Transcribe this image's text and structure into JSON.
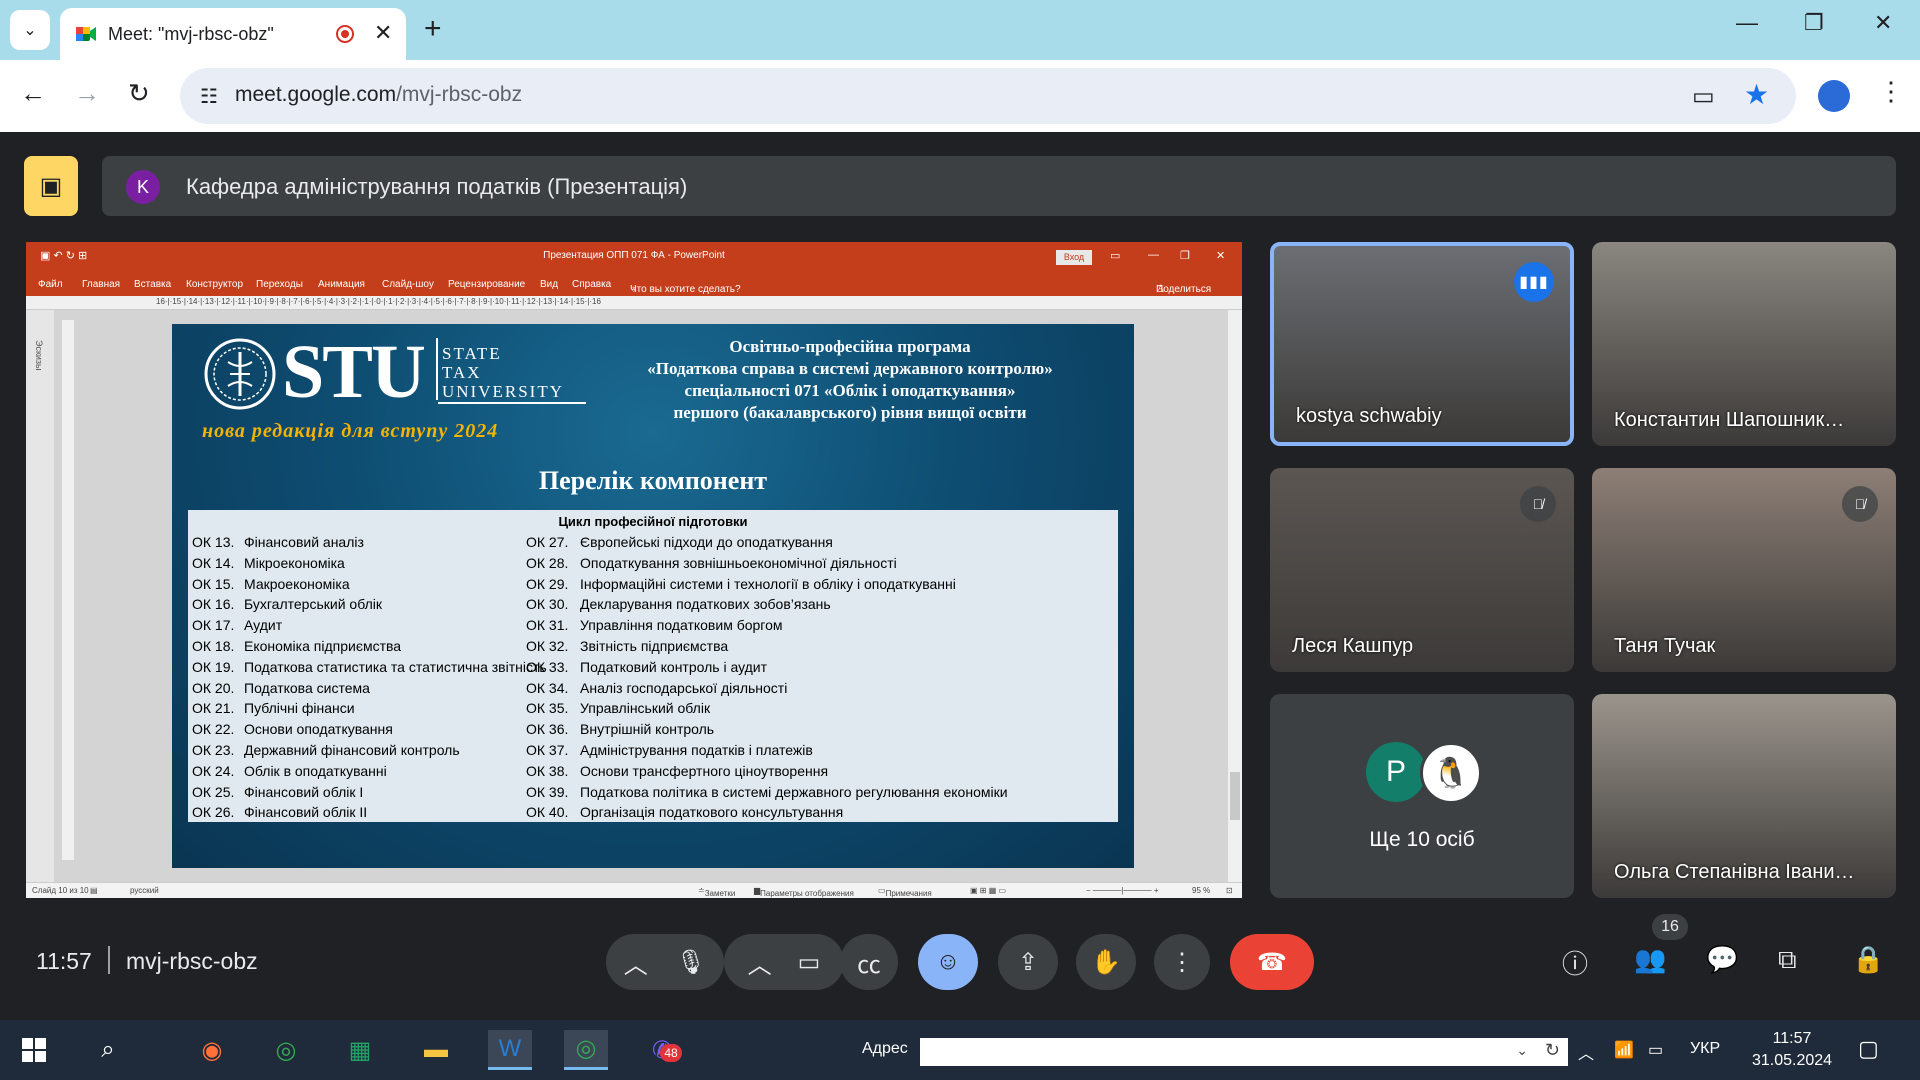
{
  "browser": {
    "tab_title": "Meet: \"mvj-rbsc-obz\"",
    "url_host": "meet.google.com",
    "url_path": "/mvj-rbsc-obz"
  },
  "meet": {
    "presenter_initial": "K",
    "presentation_title": "Кафедра адміністрування податків (Презентація)",
    "clock": "11:57",
    "meeting_code": "mvj-rbsc-obz",
    "participants_count": "16"
  },
  "powerpoint": {
    "window_title": "Презентация ОПП 071 ФА  -  PowerPoint",
    "signin": "Вход",
    "menu": [
      "Файл",
      "Главная",
      "Вставка",
      "Конструктор",
      "Переходы",
      "Анимация",
      "Слайд-шоу",
      "Рецензирование",
      "Вид",
      "Справка",
      "Что вы хотите сделать?"
    ],
    "share": "Поделиться",
    "thumbnails_label": "Эскизы",
    "status_slide": "Слайд 10 из 10",
    "status_lang": "русский",
    "status_notes": "Заметки",
    "status_display": "Параметры отображения",
    "status_comments": "Примечания",
    "status_zoom": "95 %"
  },
  "slide": {
    "logo_main": "STU",
    "logo_line1": "STATE",
    "logo_line2": "TAX",
    "logo_line3": "UNIVERSITY",
    "slogan": "нова редакція для вступу 2024",
    "headline_1": "Освітньо-професійна програма",
    "headline_2": "«Податкова справа в системі державного контролю»",
    "headline_3": "спеціальності 071 «Облік і оподаткування»",
    "headline_4": "першого (бакалаврського) рівня вищої освіти",
    "heading": "Перелік компонент",
    "table_caption": "Цикл професійної підготовки",
    "rows": [
      {
        "c1": "ОК 13.",
        "n1": "Фінансовий аналіз",
        "c2": "ОК 27.",
        "n2": "Європейські підходи до оподаткування"
      },
      {
        "c1": "ОК 14.",
        "n1": "Мікроекономіка",
        "c2": "ОК 28.",
        "n2": "Оподаткування зовнішньоекономічної діяльності"
      },
      {
        "c1": "ОК 15.",
        "n1": "Макроекономіка",
        "c2": "ОК 29.",
        "n2": "Інформаційні системи і технології в обліку і оподаткуванні"
      },
      {
        "c1": "ОК 16.",
        "n1": "Бухгалтерський облік",
        "c2": "ОК 30.",
        "n2": "Декларування податкових зобов’язань"
      },
      {
        "c1": "ОК 17.",
        "n1": "Аудит",
        "c2": "ОК 31.",
        "n2": "Управління податковим боргом"
      },
      {
        "c1": "ОК 18.",
        "n1": "Економіка підприємства",
        "c2": "ОК 32.",
        "n2": "Звітність підприємства"
      },
      {
        "c1": "ОК 19.",
        "n1": "Податкова статистика та статистична звітність",
        "c2": "ОК 33.",
        "n2": "Податковий контроль і аудит"
      },
      {
        "c1": "ОК 20.",
        "n1": "Податкова система",
        "c2": "ОК 34.",
        "n2": "Аналіз господарської діяльності"
      },
      {
        "c1": "ОК 21.",
        "n1": "Публічні фінанси",
        "c2": "ОК 35.",
        "n2": "Управлінський облік"
      },
      {
        "c1": "ОК 22.",
        "n1": "Основи оподаткування",
        "c2": "ОК 36.",
        "n2": "Внутрішній контроль"
      },
      {
        "c1": "ОК 23.",
        "n1": "Державний фінансовий контроль",
        "c2": "ОК 37.",
        "n2": "Адміністрування податків і платежів"
      },
      {
        "c1": "ОК 24.",
        "n1": "Облік в оподаткуванні",
        "c2": "ОК 38.",
        "n2": "Основи трансфертного ціноутворення"
      },
      {
        "c1": "ОК 25.",
        "n1": "Фінансовий облік І",
        "c2": "ОК 39.",
        "n2": "Податкова політика в системі державного регулювання економіки"
      },
      {
        "c1": "ОК 26.",
        "n1": "Фінансовий облік ІІ",
        "c2": "ОК 40.",
        "n2": "Організація податкового консультування"
      }
    ]
  },
  "participants": [
    {
      "name": "kostya schwabiy",
      "state": "speaking",
      "bg": "#6b6e73"
    },
    {
      "name": "Константин Шапошник…",
      "state": "none",
      "bg": "#8a8680"
    },
    {
      "name": "Леся Кашпур",
      "state": "muted",
      "bg": "#5c5652"
    },
    {
      "name": "Таня Тучак",
      "state": "muted",
      "bg": "#8d7f76"
    },
    {
      "name": "Ольга Степанівна Івани…",
      "state": "none",
      "bg": "#9b948c"
    }
  ],
  "more_tile": {
    "avatar_initial": "P",
    "label": "Ще 10 осіб"
  },
  "taskbar": {
    "address_label": "Адрес",
    "lang": "УКР",
    "time": "11:57",
    "date": "31.05.2024",
    "viber_badge": "48"
  },
  "colors": {
    "accent": "#8ab4f8",
    "end_call": "#ea4335",
    "ppt": "#c43e1c",
    "present_button": "#fdd663"
  }
}
